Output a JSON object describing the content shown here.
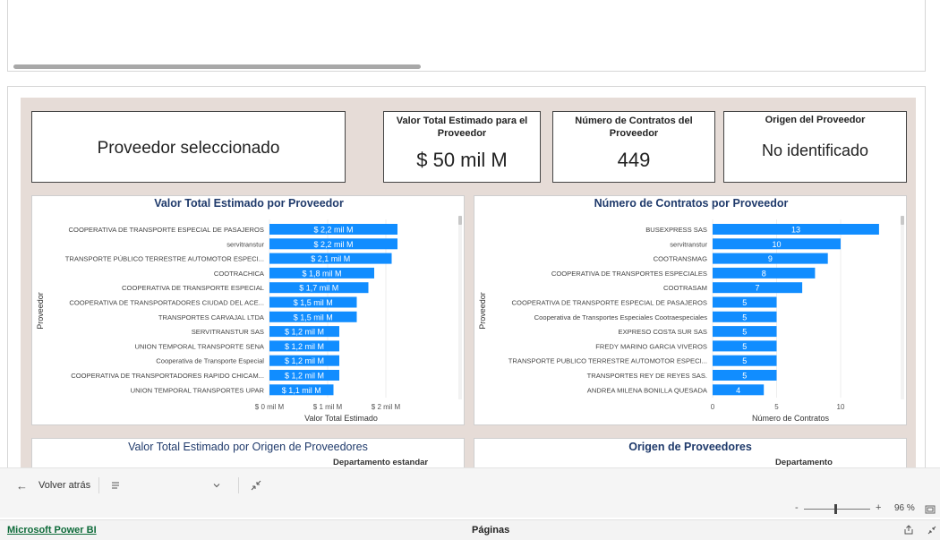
{
  "cards": {
    "selected_provider": "Proveedor seleccionado",
    "total_value_title": "Valor Total Estimado para el Proveedor",
    "total_value": "$ 50 mil M",
    "contracts_title": "Número de Contratos del Proveedor",
    "contracts_value": "449",
    "origin_title": "Origen del Proveedor",
    "origin_value": "No identificado"
  },
  "visuals": {
    "value_by_origin_title": "Valor Total Estimado por Origen de Proveedores",
    "value_by_origin_sub": "Departamento estandar",
    "origin_title": "Origen de Proveedores",
    "origin_sub": "Departamento"
  },
  "colors": {
    "bar": "#118dff",
    "report_bg": "#e6dcd7",
    "title": "#1f3a6b"
  },
  "chart_data": [
    {
      "type": "bar",
      "orientation": "horizontal",
      "title": "Valor Total Estimado por Proveedor",
      "xlabel": "Valor Total Estimado",
      "ylabel": "Proveedor",
      "xlim": [
        0,
        2.2
      ],
      "x_ticks": [
        "$ 0 mil M",
        "$ 1 mil M",
        "$ 2 mil M"
      ],
      "categories": [
        "COOPERATIVA DE TRANSPORTE ESPECIAL DE PASAJEROS",
        "servitranstur",
        "TRANSPORTE PÚBLICO TERRESTRE AUTOMOTOR ESPECI...",
        "COOTRACHICA",
        "COOPERATIVA DE TRANSPORTE ESPECIAL",
        "COOPERATIVA DE TRANSPORTADORES CIUDAD DEL ACE...",
        "TRANSPORTES CARVAJAL LTDA",
        "SERVITRANSTUR SAS",
        "UNION TEMPORAL TRANSPORTE SENA",
        "Cooperativa de Transporte Especial",
        "COOPERATIVA DE TRANSPORTADORES RAPIDO CHICAM...",
        "UNION TEMPORAL TRANSPORTES UPAR"
      ],
      "values": [
        2.2,
        2.2,
        2.1,
        1.8,
        1.7,
        1.5,
        1.5,
        1.2,
        1.2,
        1.2,
        1.2,
        1.1
      ],
      "data_labels": [
        "$ 2,2 mil M",
        "$ 2,2 mil M",
        "$ 2,1 mil M",
        "$ 1,8 mil M",
        "$ 1,7 mil M",
        "$ 1,5 mil M",
        "$ 1,5 mil M",
        "$ 1,2 mil M",
        "$ 1,2 mil M",
        "$ 1,2 mil M",
        "$ 1,2 mil M",
        "$ 1,1 mil M"
      ],
      "grid": true
    },
    {
      "type": "bar",
      "orientation": "horizontal",
      "title": "Número de Contratos por Proveedor",
      "xlabel": "Número de Contratos",
      "ylabel": "Proveedor",
      "xlim": [
        0,
        13
      ],
      "x_ticks": [
        "0",
        "5",
        "10"
      ],
      "categories": [
        "BUSEXPRESS SAS",
        "servitranstur",
        "COOTRANSMAG",
        "COOPERATIVA DE TRANSPORTES ESPECIALES",
        "COOTRASAM",
        "COOPERATIVA DE TRANSPORTE ESPECIAL DE PASAJEROS",
        "Cooperativa de Transportes Especiales Cootraespeciales",
        "EXPRESO COSTA SUR SAS",
        "FREDY MARINO GARCIA VIVEROS",
        "TRANSPORTE PUBLICO TERRESTRE AUTOMOTOR ESPECI...",
        "TRANSPORTES REY DE REYES SAS.",
        "ANDREA MILENA BONILLA QUESADA"
      ],
      "values": [
        13,
        10,
        9,
        8,
        7,
        5,
        5,
        5,
        5,
        5,
        5,
        4
      ],
      "data_labels": [
        "13",
        "10",
        "9",
        "8",
        "7",
        "5",
        "5",
        "5",
        "5",
        "5",
        "5",
        "4"
      ],
      "grid": true
    }
  ],
  "nav": {
    "back_label": "Volver atrás",
    "zoom": "96 %",
    "zoom_minus": "-",
    "zoom_plus": "+"
  },
  "status": {
    "product_link": "Microsoft Power BI",
    "pages_label": "Páginas"
  }
}
